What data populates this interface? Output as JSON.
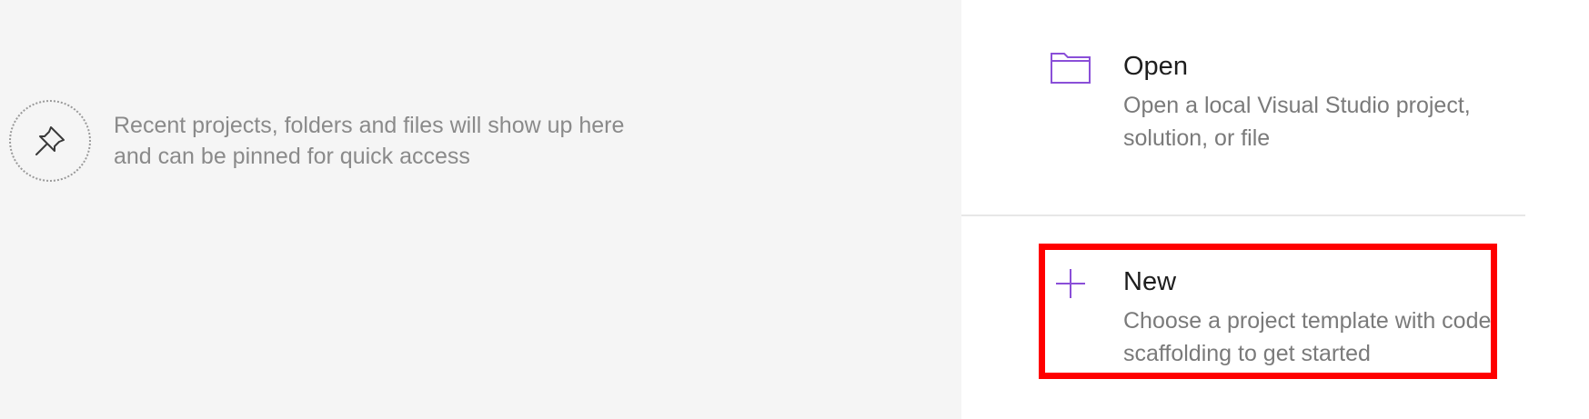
{
  "empty_state": {
    "icon": "pin-icon",
    "message": "Recent projects, folders and files will show up here and can be pinned for quick access"
  },
  "actions": {
    "open": {
      "icon": "folder-icon",
      "title": "Open",
      "description": "Open a local Visual Studio project, solution, or file"
    },
    "new": {
      "icon": "plus-icon",
      "title": "New",
      "description": "Choose a project template with code scaffolding to get started"
    }
  },
  "colors": {
    "accent": "#8a4fd8",
    "highlight": "#ff0000",
    "left_background": "#f5f5f5"
  }
}
